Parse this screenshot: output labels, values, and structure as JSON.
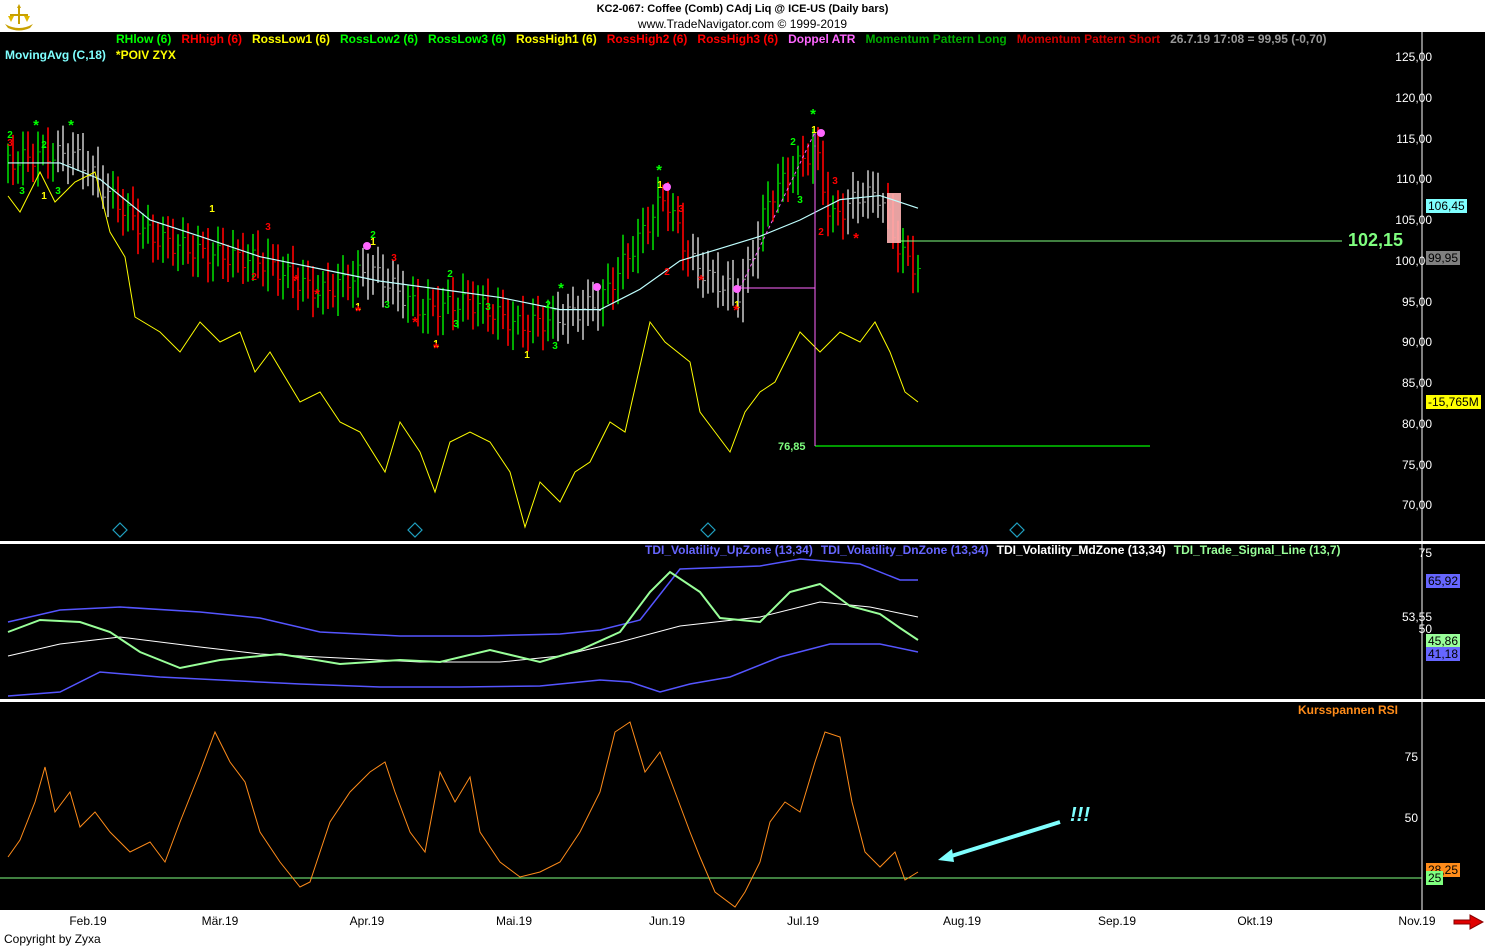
{
  "header": {
    "title": "KC2-067:  Coffee (Comb) CAdj Liq @ ICE-US  (Daily bars)",
    "source": "www.TradeNavigator.com © 1999-2019"
  },
  "legend_row1": [
    {
      "text": "RHlow (6)",
      "color": "#00ff00"
    },
    {
      "text": "RHhigh (6)",
      "color": "#ff0000"
    },
    {
      "text": "RossLow1 (6)",
      "color": "#ffff00"
    },
    {
      "text": "RossLow2 (6)",
      "color": "#00ff00"
    },
    {
      "text": "RossLow3 (6)",
      "color": "#00ff00"
    },
    {
      "text": "RossHigh1 (6)",
      "color": "#ffff00"
    },
    {
      "text": "RossHigh2 (6)",
      "color": "#ff0000"
    },
    {
      "text": "RossHigh3 (6)",
      "color": "#ff0000"
    },
    {
      "text": "Doppel ATR",
      "color": "#ff66ff"
    },
    {
      "text": "Momentum Pattern Long",
      "color": "#00aa00"
    },
    {
      "text": "Momentum Pattern Short",
      "color": "#cc0000"
    },
    {
      "text": "26.7.19 17:08 = 99,95 (-0,70)",
      "color": "#999999"
    }
  ],
  "legend_row2": [
    {
      "text": "MovingAvg (C,18)",
      "color": "#7fffff"
    },
    {
      "text": "*POIV ZYX",
      "color": "#ffff00"
    }
  ],
  "price_axis": [
    "125,00",
    "120,00",
    "115,00",
    "110,00",
    "105,00",
    "100,00",
    "95,00",
    "90,00",
    "85,00",
    "80,00",
    "75,00",
    "70,00"
  ],
  "price_tags": {
    "ma": "106,45",
    "last": "99,95",
    "poiv": "-15,765M"
  },
  "annotations": {
    "level": "102,15",
    "target": "76,85",
    "exclaim": "!!!"
  },
  "tdi": {
    "legend": [
      {
        "text": "TDI_Volatility_UpZone (13,34)",
        "color": "#6666ff"
      },
      {
        "text": "TDI_Volatility_DnZone (13,34)",
        "color": "#6666ff"
      },
      {
        "text": "TDI_Volatility_MdZone (13,34)",
        "color": "#ffffff"
      },
      {
        "text": "TDI_Trade_Signal_Line (13,7)",
        "color": "#99ff99"
      }
    ],
    "axis": [
      "75",
      "53,55",
      "50"
    ],
    "tags": {
      "up": "65,92",
      "signal": "45,86",
      "dn": "41,18"
    }
  },
  "rsi": {
    "legend": "Kursspannen RSI",
    "axis": [
      "75",
      "50"
    ],
    "tags": {
      "value": "28,25",
      "level": "25"
    }
  },
  "x_axis": [
    "Feb.19",
    "Mär.19",
    "Apr.19",
    "Mai.19",
    "Jun.19",
    "Jul.19",
    "Aug.19",
    "Sep.19",
    "Okt.19",
    "Nov.19"
  ],
  "copyright": "Copyright by Zyxa",
  "chart_data": {
    "type": "line",
    "title": "KC2-067:  Coffee (Comb) CAdj Liq @ ICE-US  (Daily bars)",
    "x": [
      "Feb.19",
      "Mär.19",
      "Apr.19",
      "Mai.19",
      "Jun.19",
      "Jul.19",
      "Aug.19"
    ],
    "series": [
      {
        "name": "MovingAvg (C,18)",
        "values": [
          111,
          103,
          99,
          94,
          99,
          104,
          106.45
        ]
      },
      {
        "name": "TDI_Volatility_UpZone (13,34)",
        "values": [
          66,
          52,
          52,
          52,
          75,
          75,
          65.92
        ]
      },
      {
        "name": "TDI_Trade_Signal_Line (13,7)",
        "values": [
          60,
          42,
          46,
          42,
          75,
          65,
          45.86
        ]
      },
      {
        "name": "TDI_Volatility_DnZone (13,34)",
        "values": [
          28,
          30,
          30,
          30,
          22,
          38,
          41.18
        ]
      },
      {
        "name": "Kursspannen RSI",
        "values": [
          45,
          80,
          70,
          30,
          90,
          85,
          28.25
        ]
      }
    ],
    "levels": {
      "resistance": 102.15,
      "target": 76.85,
      "last": 99.95
    },
    "ylim": [
      67,
      127
    ]
  }
}
